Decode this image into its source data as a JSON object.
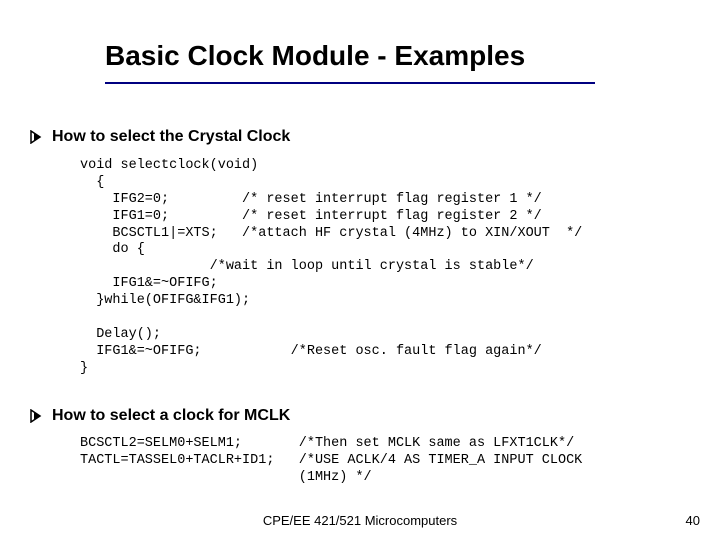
{
  "title": "Basic Clock Module - Examples",
  "bullets": {
    "b1": "How to select the Crystal Clock",
    "b2": "How to select a clock for MCLK"
  },
  "code1": "void selectclock(void)\n  {\n    IFG2=0;         /* reset interrupt flag register 1 */\n    IFG1=0;         /* reset interrupt flag register 2 */\n    BCSCTL1|=XTS;   /*attach HF crystal (4MHz) to XIN/XOUT  */\n    do {\n                /*wait in loop until crystal is stable*/\n    IFG1&=~OFIFG;\n  }while(OFIFG&IFG1);\n\n  Delay();\n  IFG1&=~OFIFG;           /*Reset osc. fault flag again*/\n}",
  "code2": "BCSCTL2=SELM0+SELM1;       /*Then set MCLK same as LFXT1CLK*/\nTACTL=TASSEL0+TACLR+ID1;   /*USE ACLK/4 AS TIMER_A INPUT CLOCK\n                           (1MHz) */",
  "footer": "CPE/EE 421/521 Microcomputers",
  "page": "40"
}
